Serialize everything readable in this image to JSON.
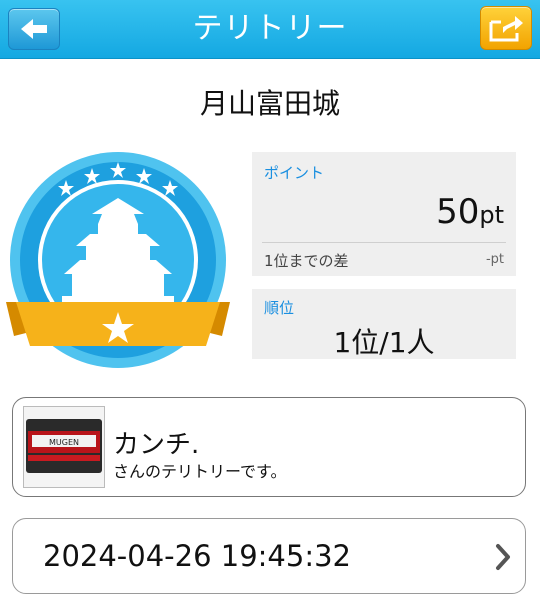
{
  "header": {
    "title": "テリトリー",
    "back_icon": "arrow-left-icon",
    "share_icon": "share-icon",
    "accent_color": "#1eaee6",
    "share_color": "#f5b400"
  },
  "castle": {
    "name": "月山富田城",
    "badge_icon": "castle-badge-icon"
  },
  "points": {
    "label": "ポイント",
    "value": "50",
    "unit": "pt",
    "diff_label": "1位までの差",
    "diff_value": "-pt"
  },
  "rank": {
    "label": "順位",
    "value": "1位/1人"
  },
  "owner": {
    "name": "カンチ.",
    "subtitle": "さんのテリトリーです。",
    "thumb_label": "MUGEN"
  },
  "visit": {
    "datetime": "2024-04-26 19:45:32",
    "chevron_icon": "chevron-right-icon"
  }
}
